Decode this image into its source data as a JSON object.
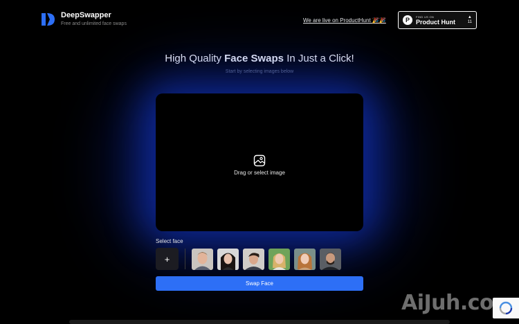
{
  "header": {
    "brand_name": "DeepSwapper",
    "brand_tagline": "Free and unlimited face swaps",
    "producthunt_link": "We are live on ProductHunt 🎉🎉",
    "ph_badge": {
      "small_text": "FIND US ON",
      "big_text": "Product Hunt",
      "logo_letter": "P",
      "arrow": "▲",
      "votes": "11"
    }
  },
  "hero": {
    "headline_pre": "High Quality ",
    "headline_bold": "Face Swaps",
    "headline_post": " In Just a Click!",
    "subline": "Start by selecting images below"
  },
  "upload": {
    "label": "Drag or select image"
  },
  "faces": {
    "label": "Select face",
    "add_label": "+",
    "items": [
      "face-1",
      "face-2",
      "face-3",
      "face-4",
      "face-5",
      "face-6"
    ]
  },
  "swap_button": "Swap Face",
  "watermark": "AiJuh.com",
  "colors": {
    "accent": "#2d6ff6",
    "glow": "#1438dc",
    "background": "#000000"
  }
}
